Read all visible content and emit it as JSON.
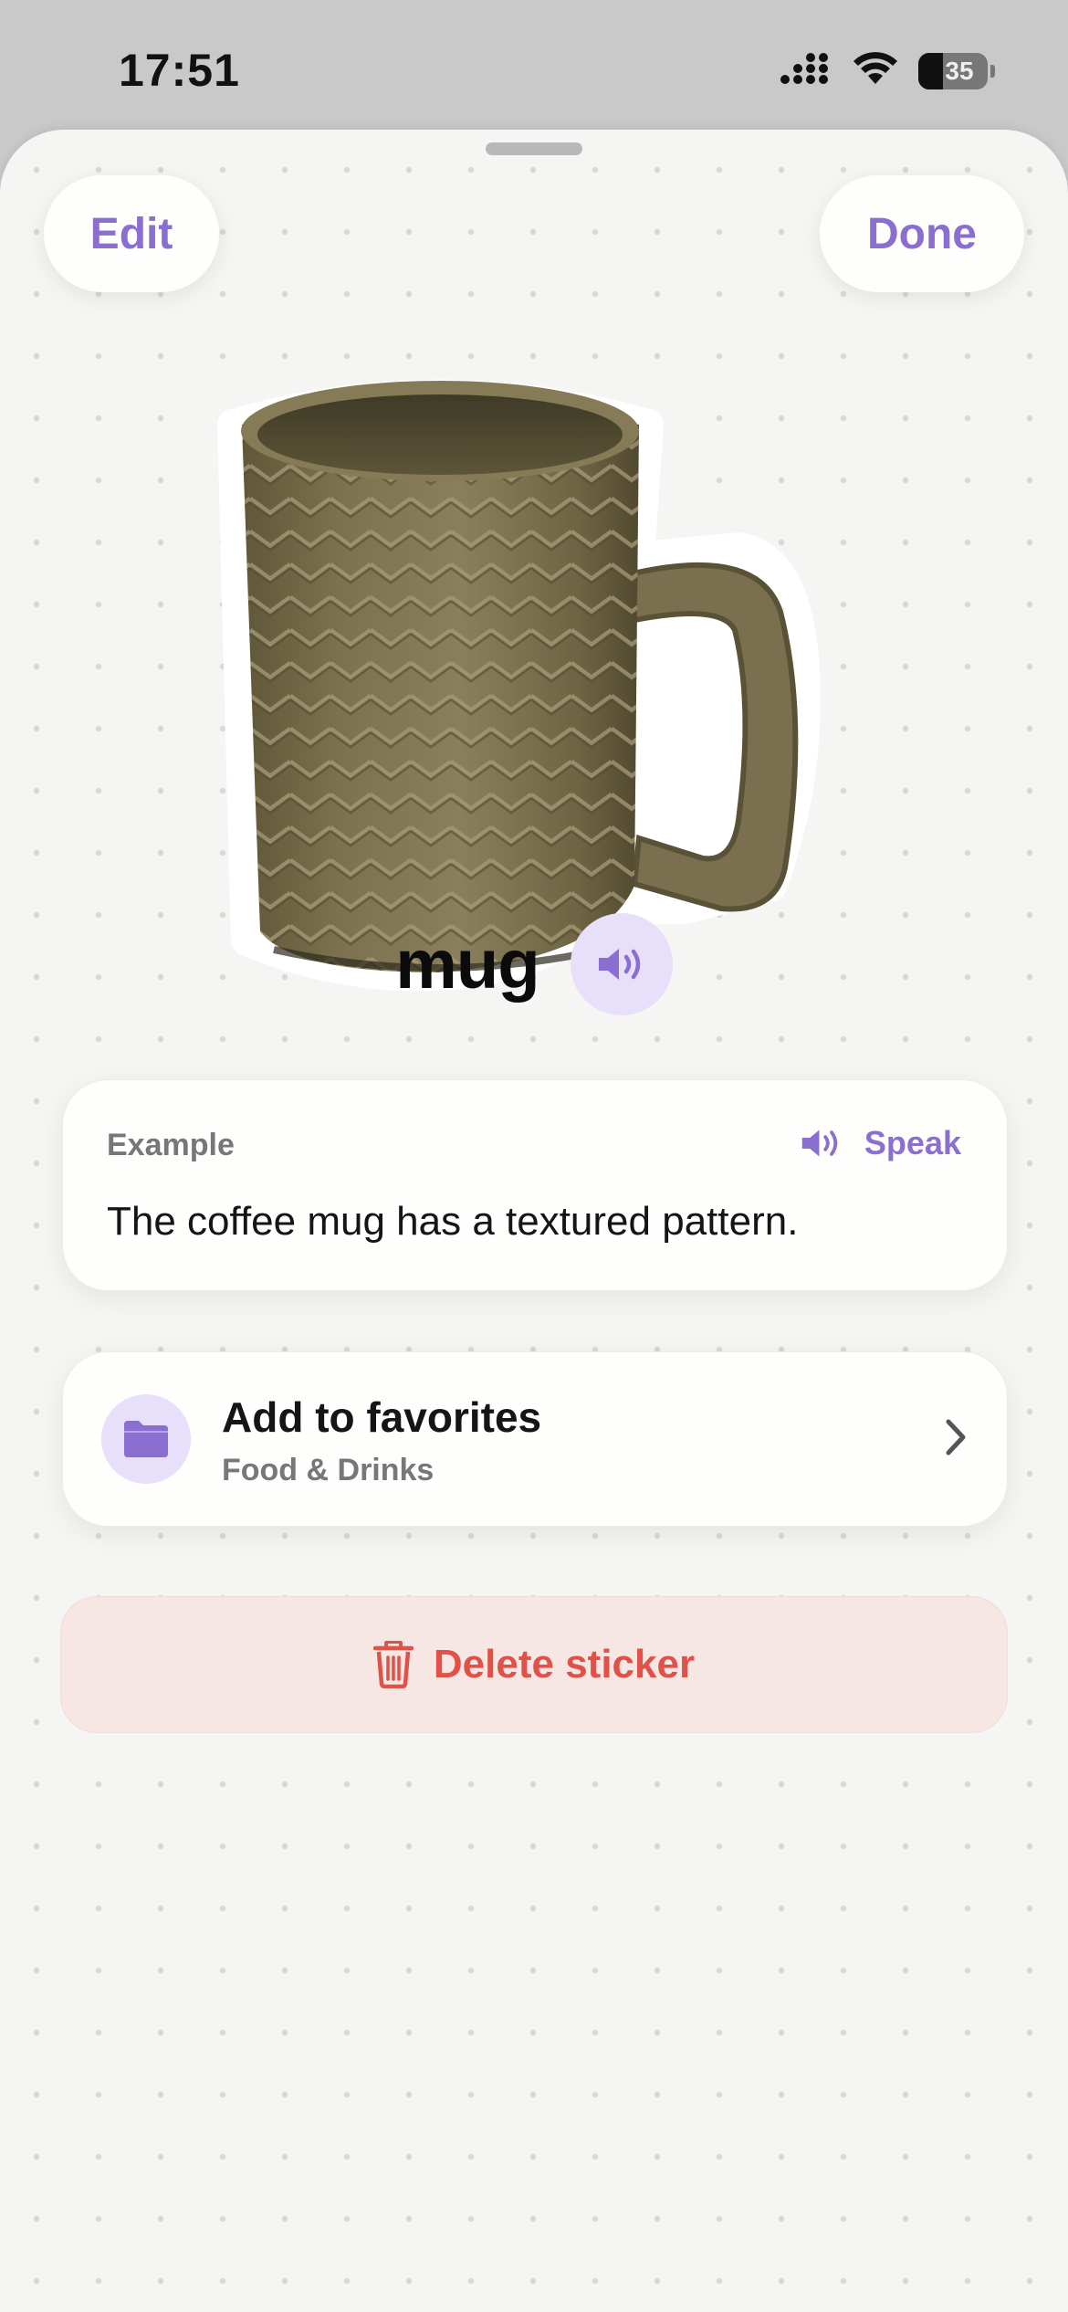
{
  "status_bar": {
    "time": "17:51",
    "battery_level": "35",
    "icons": [
      "cellular-signal-icon",
      "wifi-icon",
      "battery-icon"
    ]
  },
  "sheet": {
    "edit_label": "Edit",
    "done_label": "Done"
  },
  "sticker": {
    "word": "mug",
    "image": "mug-sticker-image"
  },
  "example": {
    "label": "Example",
    "speak_label": "Speak",
    "sentence": "The coffee mug has a textured pattern."
  },
  "favorites": {
    "title": "Add to favorites",
    "category": "Food & Drinks"
  },
  "delete": {
    "label": "Delete sticker"
  },
  "colors": {
    "accent": "#8a6fd0",
    "accent_soft": "#e8e0fa",
    "danger": "#e05148",
    "danger_soft": "#f6e6e4",
    "background": "#f5f5f3"
  }
}
